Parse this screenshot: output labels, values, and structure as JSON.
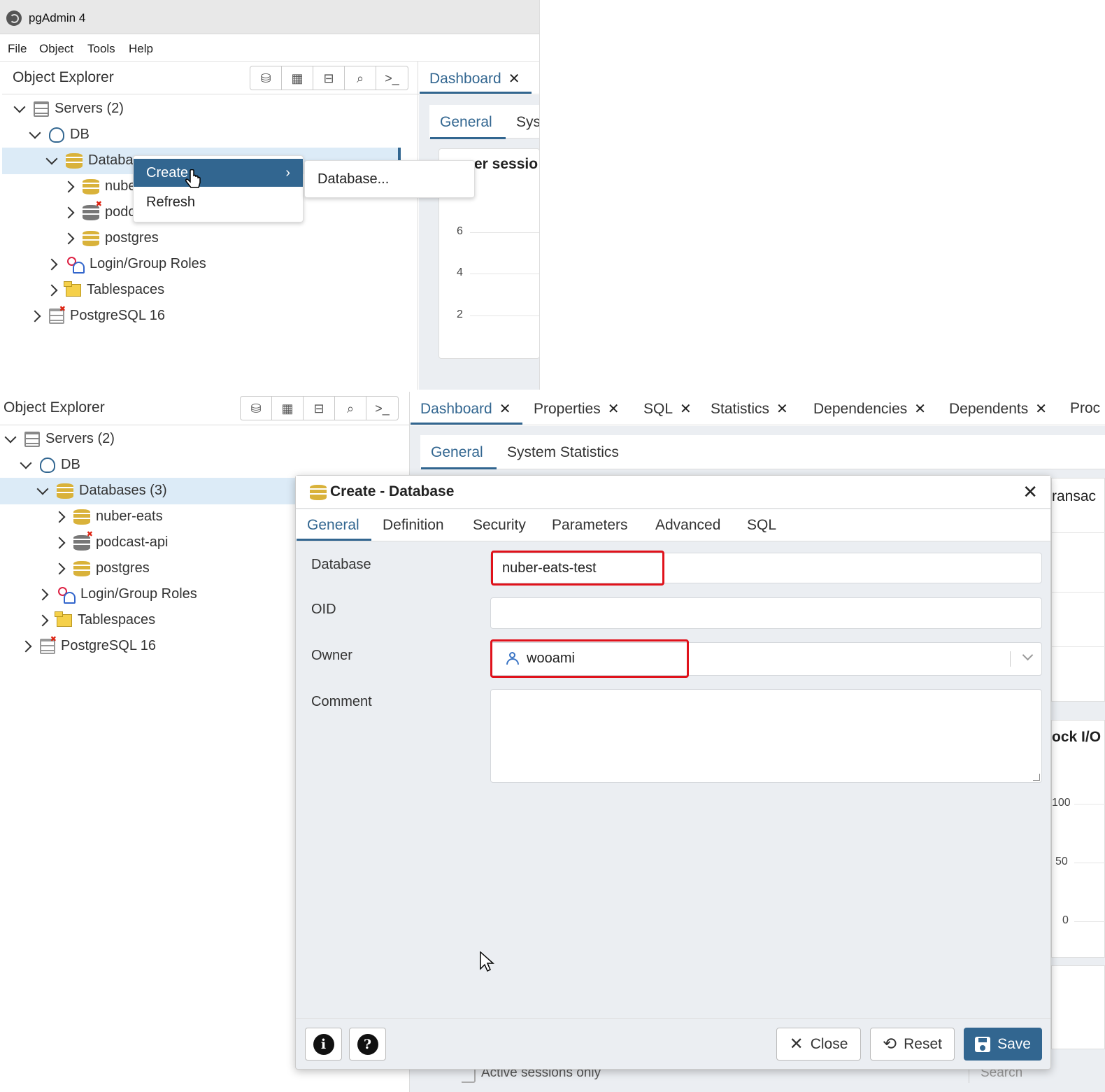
{
  "app": {
    "title": "pgAdmin 4"
  },
  "menu": [
    "File",
    "Object",
    "Tools",
    "Help"
  ],
  "object_explorer": {
    "label": "Object Explorer"
  },
  "tree": {
    "servers": "Servers (2)",
    "db": "DB",
    "databases_truncated": "Databa",
    "databases": "Databases (3)",
    "db_items_truncated": [
      "nube",
      "podc",
      "postgres"
    ],
    "db_items": [
      "nuber-eats",
      "podcast-api",
      "postgres"
    ],
    "login_roles": "Login/Group Roles",
    "tablespaces": "Tablespaces",
    "pg16": "PostgreSQL 16"
  },
  "top_tabs": {
    "dashboard": "Dashboard",
    "general": "General",
    "sys_truncated": "Sys",
    "panel_title_fragment": "er sessio",
    "y_ticks": [
      "6",
      "4",
      "2"
    ]
  },
  "context_menu": {
    "create": "Create",
    "refresh": "Refresh",
    "submenu_database": "Database..."
  },
  "bottom_tabs": [
    "Dashboard",
    "Properties",
    "SQL",
    "Statistics",
    "Dependencies",
    "Dependents",
    "Proc"
  ],
  "dashboard_subtabs": {
    "general": "General",
    "system_statistics": "System Statistics"
  },
  "background_fragments": {
    "transac": "ransac",
    "blockio": "ock I/O",
    "y_ticks": [
      "100",
      "50",
      "0"
    ],
    "active_sessions": "Active sessions only",
    "search": "Search"
  },
  "dialog": {
    "title": "Create - Database",
    "tabs": [
      "General",
      "Definition",
      "Security",
      "Parameters",
      "Advanced",
      "SQL"
    ],
    "fields": {
      "database_label": "Database",
      "database_value": "nuber-eats-test",
      "oid_label": "OID",
      "oid_value": "",
      "owner_label": "Owner",
      "owner_value": "wooami",
      "comment_label": "Comment",
      "comment_value": ""
    },
    "buttons": {
      "close": "Close",
      "reset": "Reset",
      "save": "Save"
    },
    "info_glyph": "i",
    "help_glyph": "?"
  },
  "colors": {
    "accent": "#326690",
    "highlight_row": "#dcebf7",
    "error_outline": "#e0121b"
  }
}
